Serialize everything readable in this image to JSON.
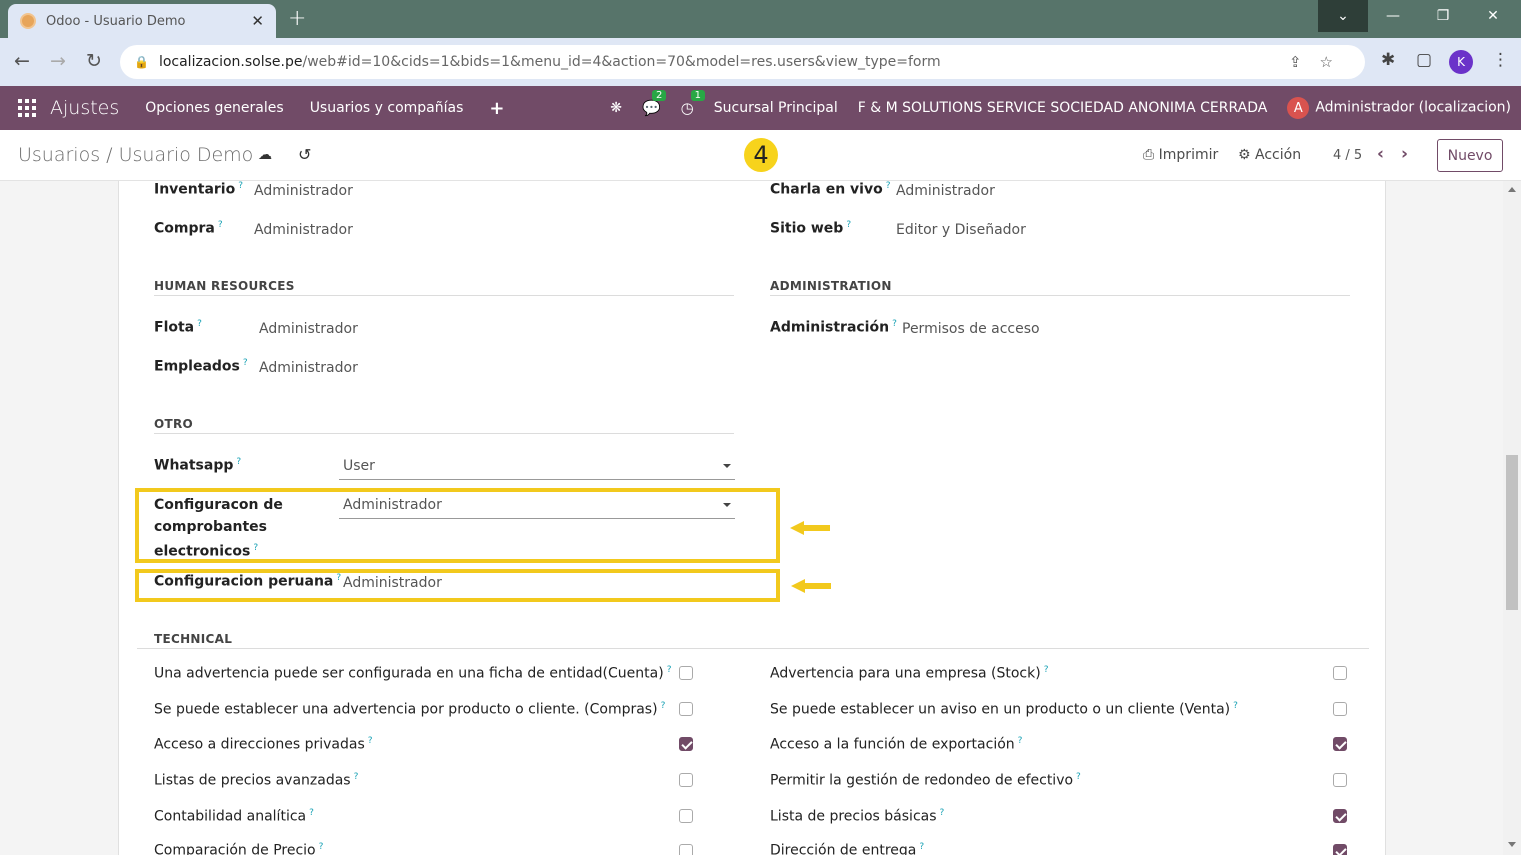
{
  "browser": {
    "tab_title": "Odoo - Usuario Demo",
    "tab_close": "✕",
    "new_tab": "+",
    "url_host": "localizacion.solse.pe",
    "url_path": "/web#id=10&cids=1&bids=1&menu_id=4&action=70&model=res.users&view_type=form",
    "profile_initial": "K"
  },
  "navbar": {
    "app_name": "Ajustes",
    "menu": [
      "Opciones generales",
      "Usuarios y compañías"
    ],
    "messages_count": "2",
    "activities_count": "1",
    "branch": "Sucursal Principal",
    "company": "F & M SOLUTIONS SERVICE SOCIEDAD ANONIMA CERRADA",
    "user_initial": "A",
    "user": "Administrador (localizacion)"
  },
  "control_panel": {
    "breadcrumb_parent": "Usuarios",
    "breadcrumb_sep": "/",
    "breadcrumb_current": "Usuario Demo",
    "step_number": "4",
    "print": "Imprimir",
    "action": "Acción",
    "pager": "4 / 5",
    "new_button": "Nuevo"
  },
  "form": {
    "top_rows": [
      {
        "label": "Inventario",
        "value": "Administrador"
      },
      {
        "label": "Compra",
        "value": "Administrador"
      }
    ],
    "top_rows_right": [
      {
        "label": "Charla en vivo",
        "value": "Administrador"
      },
      {
        "label": "Sitio web",
        "value": "Editor y Diseñador"
      }
    ],
    "hr_section": "HUMAN RESOURCES",
    "hr_rows": [
      {
        "label": "Flota",
        "value": "Administrador"
      },
      {
        "label": "Empleados",
        "value": "Administrador"
      }
    ],
    "admin_section": "ADMINISTRATION",
    "admin_row": {
      "label": "Administración",
      "value": "Permisos de acceso"
    },
    "otro_section": "OTRO",
    "whatsapp": {
      "label": "Whatsapp",
      "value": "User"
    },
    "config_comprobantes": {
      "label_lines": [
        "Configuracon de",
        "comprobantes",
        "electronicos"
      ],
      "value": "Administrador"
    },
    "config_peruana": {
      "label": "Configuracion peruana",
      "value": "Administrador"
    },
    "help_mark": "?",
    "technical_section": "TECHNICAL",
    "technical_left": [
      {
        "label": "Una advertencia puede ser configurada en una ficha de entidad(Cuenta)",
        "checked": false
      },
      {
        "label": "Se puede establecer una advertencia por producto o cliente. (Compras)",
        "checked": false
      },
      {
        "label": "Acceso a direcciones privadas",
        "checked": true
      },
      {
        "label": "Listas de precios avanzadas",
        "checked": false
      },
      {
        "label": "Contabilidad analítica",
        "checked": false
      },
      {
        "label": "Comparación de Precio",
        "checked": false
      }
    ],
    "technical_right": [
      {
        "label": "Advertencia para una empresa (Stock)",
        "checked": false
      },
      {
        "label": "Se puede establecer un aviso en un producto o un cliente (Venta)",
        "checked": false
      },
      {
        "label": "Acceso a la función de exportación",
        "checked": true
      },
      {
        "label": "Permitir la gestión de redondeo de efectivo",
        "checked": false
      },
      {
        "label": "Lista de precios básicas",
        "checked": true
      },
      {
        "label": "Dirección de entrega",
        "checked": true
      }
    ]
  },
  "colors": {
    "odoo_primary": "#714b67",
    "highlight": "#f2c91d"
  }
}
